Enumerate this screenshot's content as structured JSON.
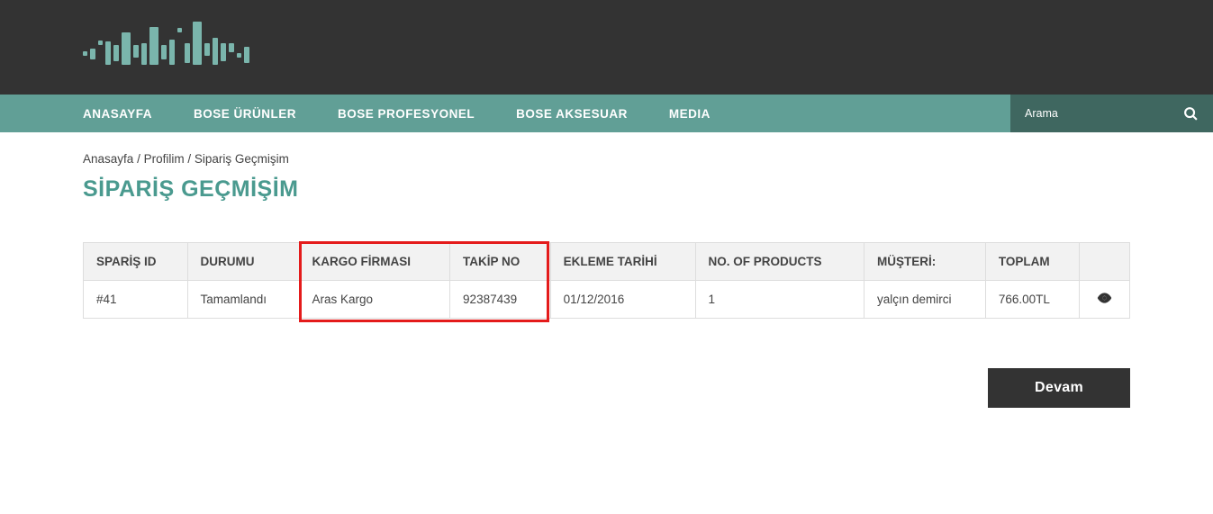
{
  "nav": {
    "items": [
      "ANASAYFA",
      "BOSE ÜRÜNLER",
      "BOSE PROFESYONEL",
      "BOSE AKSESUAR",
      "MEDIA"
    ],
    "search_placeholder": "Arama"
  },
  "breadcrumb": {
    "home": "Anasayfa",
    "profile": "Profilim",
    "current": "Sipariş Geçmişim"
  },
  "page": {
    "title": "SİPARİŞ GEÇMİŞİM"
  },
  "table": {
    "headers": {
      "order_id": "SPARİŞ ID",
      "status": "DURUMU",
      "shipping_company": "KARGO FİRMASI",
      "tracking_no": "TAKİP NO",
      "date_added": "EKLEME TARİHİ",
      "num_products": "NO. OF PRODUCTS",
      "customer": "MÜŞTERİ:",
      "total": "TOPLAM"
    },
    "rows": [
      {
        "order_id": "#41",
        "status": "Tamamlandı",
        "shipping_company": "Aras Kargo",
        "tracking_no": "92387439",
        "date_added": "01/12/2016",
        "num_products": "1",
        "customer": "yalçın demirci",
        "total": "766.00TL"
      }
    ]
  },
  "buttons": {
    "continue": "Devam"
  }
}
